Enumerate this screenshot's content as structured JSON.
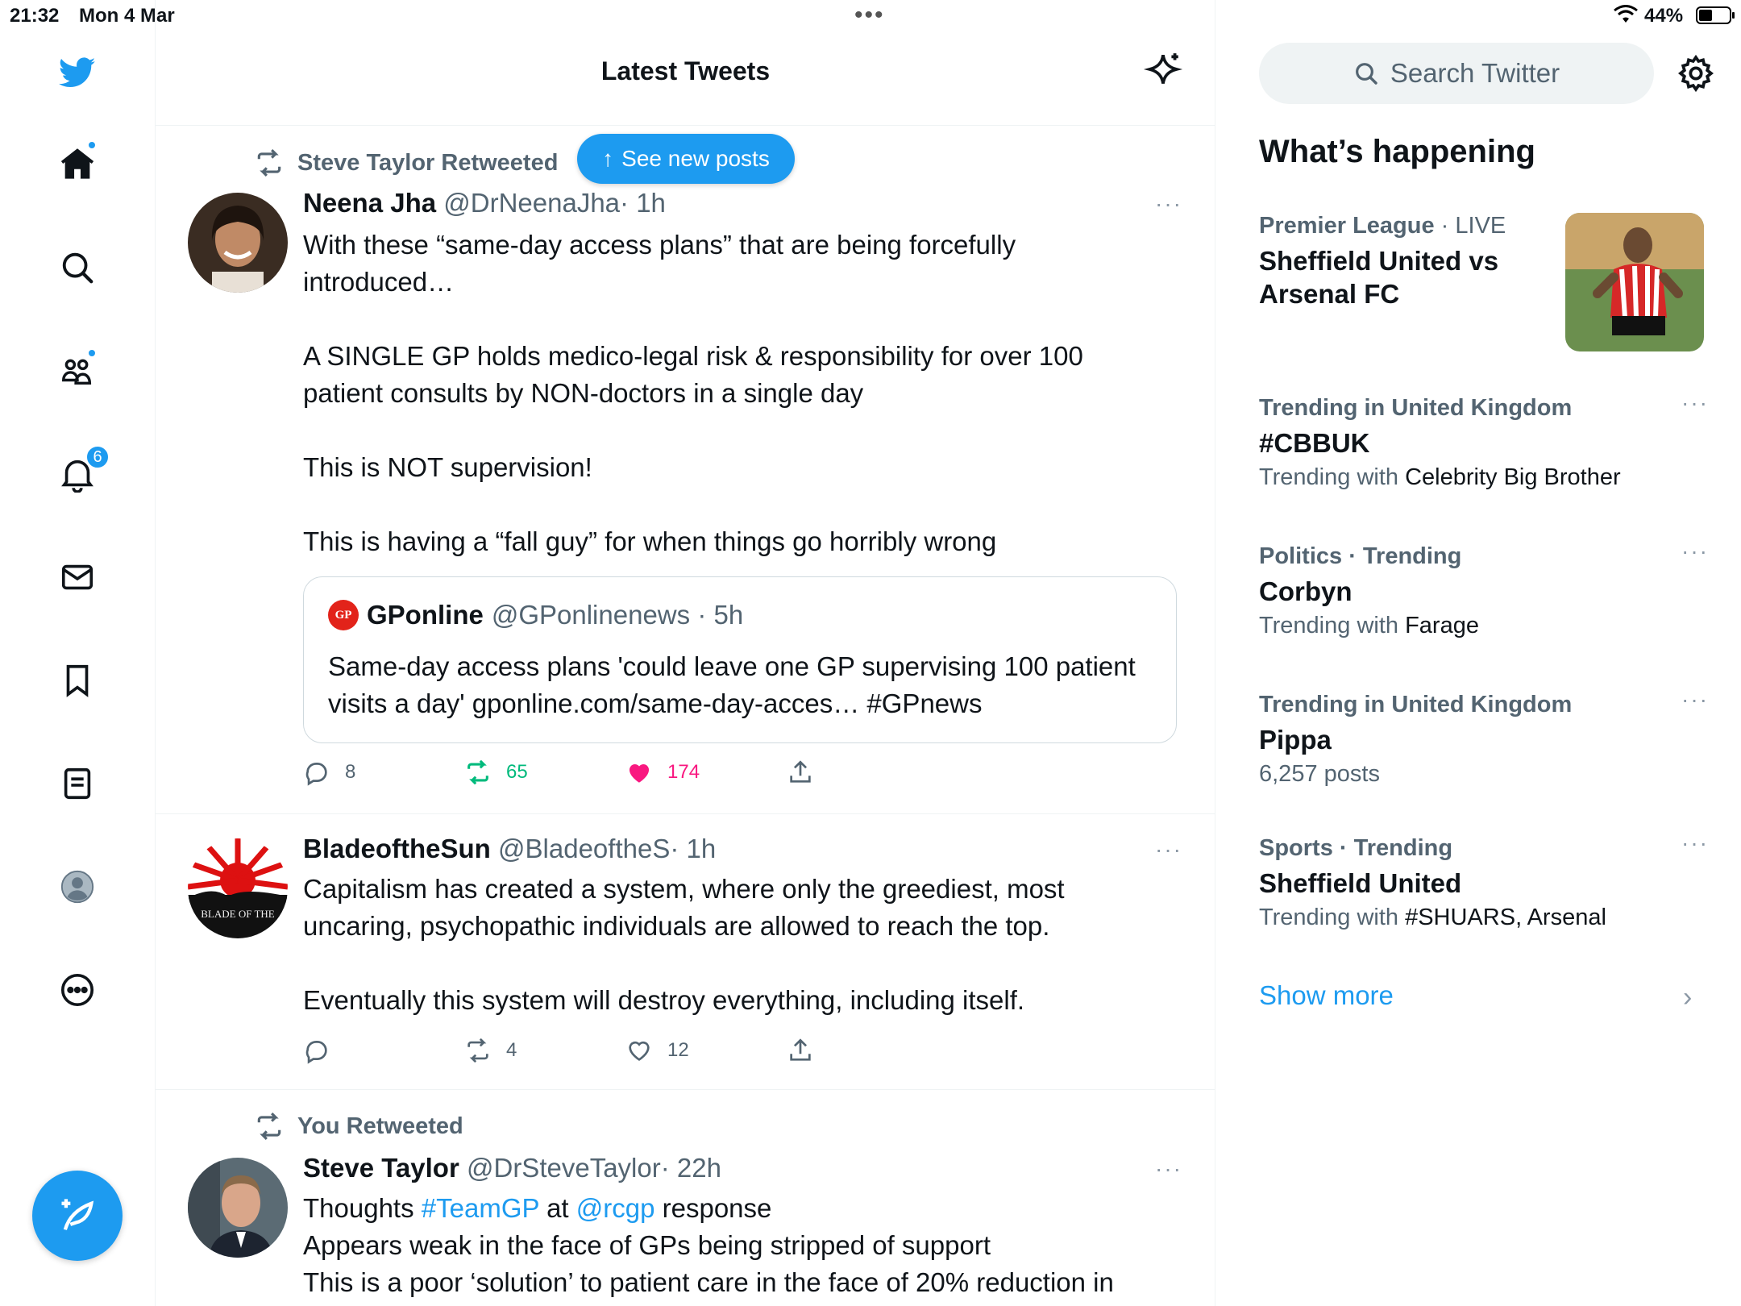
{
  "status_bar": {
    "time": "21:32",
    "date": "Mon 4 Mar",
    "battery": "44%",
    "center_dots": "•••"
  },
  "nav": {
    "notifications_count": "6"
  },
  "header": {
    "title": "Latest Tweets"
  },
  "see_new_posts": {
    "label": "See new posts",
    "arrow": "↑"
  },
  "tweets": [
    {
      "retweeted_by": "Steve Taylor Retweeted",
      "name": "Neena Jha",
      "handle": "@DrNeenaJha",
      "time": "· 1h",
      "more": "···",
      "body": [
        "With these “same-day access plans” that are being forcefully introduced…",
        "",
        "A SINGLE GP holds medico-legal risk & responsibility for over 100 patient consults by NON-doctors in a single day",
        "",
        "This is NOT supervision!",
        "",
        "This is having a “fall guy” for when things go horribly wrong"
      ],
      "quote": {
        "logo_text": "GP",
        "name": "GPonline",
        "handle": "@GPonlinenews",
        "time": "· 5h",
        "body": "Same-day access plans 'could leave one GP supervising 100 patient visits a day' gponline.com/same-day-acces… #GPnews"
      },
      "replies": "8",
      "retweets": "65",
      "likes": "174"
    },
    {
      "name": "BladeoftheSun",
      "handle": "@BladeoftheS",
      "time": "· 1h",
      "more": "···",
      "body": [
        "Capitalism has created a system, where only the greediest, most uncaring, psychopathic individuals are allowed to reach the top.",
        "",
        "Eventually this system will destroy everything, including itself."
      ],
      "avatar_text": "BLADE OF THE",
      "replies": "",
      "retweets": "4",
      "likes": "12"
    },
    {
      "retweeted_by": "You Retweeted",
      "name": "Steve Taylor",
      "handle": "@DrSteveTaylor",
      "time": "· 22h",
      "more": "···",
      "body_parts": {
        "l1_a": "Thoughts ",
        "l1_link1": "#TeamGP",
        "l1_b": " at ",
        "l1_link2": "@rcgp",
        "l1_c": " response",
        "l2": "Appears weak in the face of GPs being stripped of support",
        "l3": "This is a poor ‘solution’ to patient care in the face of 20% reduction in"
      }
    }
  ],
  "sidebar": {
    "search_placeholder": "Search Twitter",
    "heading": "What’s happening",
    "trends": [
      {
        "context_bold": "Premier League",
        "context_rest": " · LIVE",
        "title": "Sheffield United vs Arsenal FC"
      },
      {
        "context_bold": "Trending in United Kingdom",
        "title": "#CBBUK",
        "sub_prefix": "Trending with ",
        "sub_value": "Celebrity Big Brother",
        "more": "···"
      },
      {
        "context_bold": "Politics · Trending",
        "title": "Corbyn",
        "sub_prefix": "Trending with ",
        "sub_value": "Farage",
        "more": "···"
      },
      {
        "context_bold": "Trending in United Kingdom",
        "title": "Pippa",
        "sub_plain": "6,257 posts",
        "more": "···"
      },
      {
        "context_bold": "Sports · Trending",
        "title": "Sheffield United",
        "sub_prefix": "Trending with ",
        "sub_value": "#SHUARS, Arsenal",
        "more": "···"
      }
    ],
    "show_more": "Show more",
    "chevron": "›"
  },
  "colors": {
    "accent": "#1d9bf0",
    "retweet_green": "#00ba7c",
    "like_pink": "#f91880",
    "muted": "#536471"
  }
}
